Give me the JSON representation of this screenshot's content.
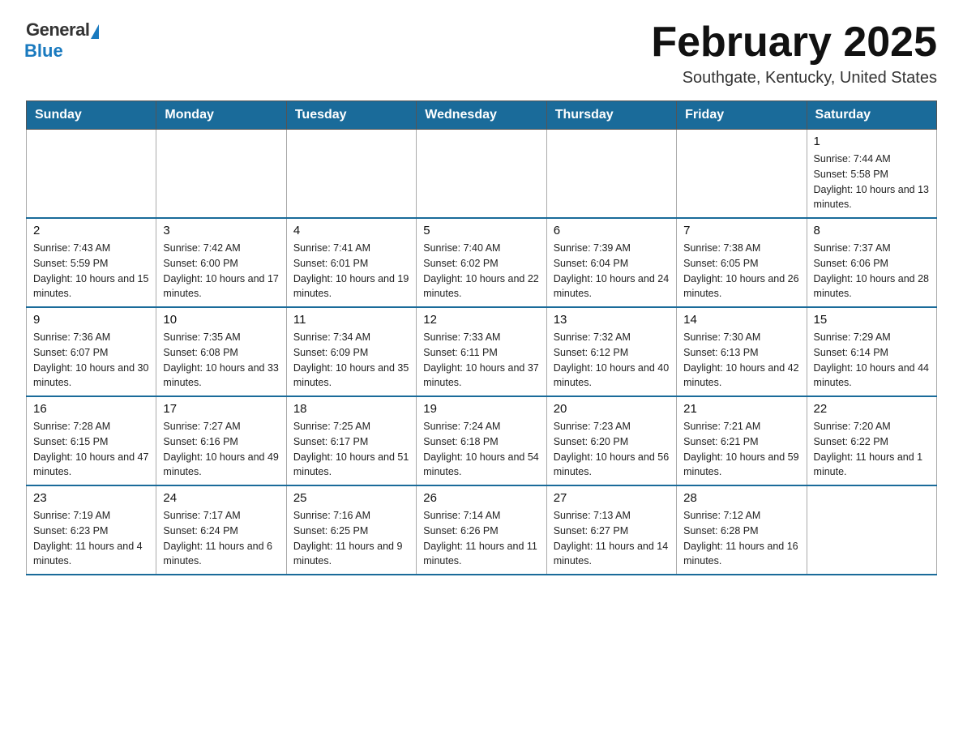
{
  "logo": {
    "general": "General",
    "blue": "Blue"
  },
  "title": "February 2025",
  "subtitle": "Southgate, Kentucky, United States",
  "weekdays": [
    "Sunday",
    "Monday",
    "Tuesday",
    "Wednesday",
    "Thursday",
    "Friday",
    "Saturday"
  ],
  "weeks": [
    [
      {
        "day": "",
        "info": ""
      },
      {
        "day": "",
        "info": ""
      },
      {
        "day": "",
        "info": ""
      },
      {
        "day": "",
        "info": ""
      },
      {
        "day": "",
        "info": ""
      },
      {
        "day": "",
        "info": ""
      },
      {
        "day": "1",
        "info": "Sunrise: 7:44 AM\nSunset: 5:58 PM\nDaylight: 10 hours and 13 minutes."
      }
    ],
    [
      {
        "day": "2",
        "info": "Sunrise: 7:43 AM\nSunset: 5:59 PM\nDaylight: 10 hours and 15 minutes."
      },
      {
        "day": "3",
        "info": "Sunrise: 7:42 AM\nSunset: 6:00 PM\nDaylight: 10 hours and 17 minutes."
      },
      {
        "day": "4",
        "info": "Sunrise: 7:41 AM\nSunset: 6:01 PM\nDaylight: 10 hours and 19 minutes."
      },
      {
        "day": "5",
        "info": "Sunrise: 7:40 AM\nSunset: 6:02 PM\nDaylight: 10 hours and 22 minutes."
      },
      {
        "day": "6",
        "info": "Sunrise: 7:39 AM\nSunset: 6:04 PM\nDaylight: 10 hours and 24 minutes."
      },
      {
        "day": "7",
        "info": "Sunrise: 7:38 AM\nSunset: 6:05 PM\nDaylight: 10 hours and 26 minutes."
      },
      {
        "day": "8",
        "info": "Sunrise: 7:37 AM\nSunset: 6:06 PM\nDaylight: 10 hours and 28 minutes."
      }
    ],
    [
      {
        "day": "9",
        "info": "Sunrise: 7:36 AM\nSunset: 6:07 PM\nDaylight: 10 hours and 30 minutes."
      },
      {
        "day": "10",
        "info": "Sunrise: 7:35 AM\nSunset: 6:08 PM\nDaylight: 10 hours and 33 minutes."
      },
      {
        "day": "11",
        "info": "Sunrise: 7:34 AM\nSunset: 6:09 PM\nDaylight: 10 hours and 35 minutes."
      },
      {
        "day": "12",
        "info": "Sunrise: 7:33 AM\nSunset: 6:11 PM\nDaylight: 10 hours and 37 minutes."
      },
      {
        "day": "13",
        "info": "Sunrise: 7:32 AM\nSunset: 6:12 PM\nDaylight: 10 hours and 40 minutes."
      },
      {
        "day": "14",
        "info": "Sunrise: 7:30 AM\nSunset: 6:13 PM\nDaylight: 10 hours and 42 minutes."
      },
      {
        "day": "15",
        "info": "Sunrise: 7:29 AM\nSunset: 6:14 PM\nDaylight: 10 hours and 44 minutes."
      }
    ],
    [
      {
        "day": "16",
        "info": "Sunrise: 7:28 AM\nSunset: 6:15 PM\nDaylight: 10 hours and 47 minutes."
      },
      {
        "day": "17",
        "info": "Sunrise: 7:27 AM\nSunset: 6:16 PM\nDaylight: 10 hours and 49 minutes."
      },
      {
        "day": "18",
        "info": "Sunrise: 7:25 AM\nSunset: 6:17 PM\nDaylight: 10 hours and 51 minutes."
      },
      {
        "day": "19",
        "info": "Sunrise: 7:24 AM\nSunset: 6:18 PM\nDaylight: 10 hours and 54 minutes."
      },
      {
        "day": "20",
        "info": "Sunrise: 7:23 AM\nSunset: 6:20 PM\nDaylight: 10 hours and 56 minutes."
      },
      {
        "day": "21",
        "info": "Sunrise: 7:21 AM\nSunset: 6:21 PM\nDaylight: 10 hours and 59 minutes."
      },
      {
        "day": "22",
        "info": "Sunrise: 7:20 AM\nSunset: 6:22 PM\nDaylight: 11 hours and 1 minute."
      }
    ],
    [
      {
        "day": "23",
        "info": "Sunrise: 7:19 AM\nSunset: 6:23 PM\nDaylight: 11 hours and 4 minutes."
      },
      {
        "day": "24",
        "info": "Sunrise: 7:17 AM\nSunset: 6:24 PM\nDaylight: 11 hours and 6 minutes."
      },
      {
        "day": "25",
        "info": "Sunrise: 7:16 AM\nSunset: 6:25 PM\nDaylight: 11 hours and 9 minutes."
      },
      {
        "day": "26",
        "info": "Sunrise: 7:14 AM\nSunset: 6:26 PM\nDaylight: 11 hours and 11 minutes."
      },
      {
        "day": "27",
        "info": "Sunrise: 7:13 AM\nSunset: 6:27 PM\nDaylight: 11 hours and 14 minutes."
      },
      {
        "day": "28",
        "info": "Sunrise: 7:12 AM\nSunset: 6:28 PM\nDaylight: 11 hours and 16 minutes."
      },
      {
        "day": "",
        "info": ""
      }
    ]
  ]
}
